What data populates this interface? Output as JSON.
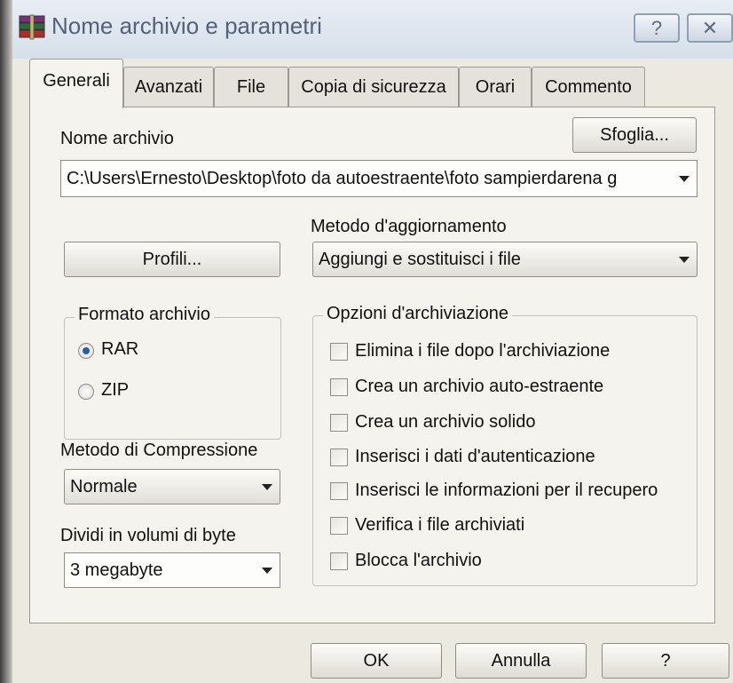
{
  "window": {
    "title": "Nome archivio e parametri",
    "help_label": "?",
    "close_label": "✕"
  },
  "tabs": [
    {
      "label": "Generali",
      "active": true
    },
    {
      "label": "Avanzati",
      "active": false
    },
    {
      "label": "File",
      "active": false
    },
    {
      "label": "Copia di sicurezza",
      "active": false
    },
    {
      "label": "Orari",
      "active": false
    },
    {
      "label": "Commento",
      "active": false
    }
  ],
  "general": {
    "archive_name_label": "Nome archivio",
    "browse_label": "Sfoglia...",
    "archive_path": "C:\\Users\\Ernesto\\Desktop\\foto da autoestraente\\foto sampierdarena g",
    "profiles_label": "Profili...",
    "update_method_label": "Metodo d'aggiornamento",
    "update_method_value": "Aggiungi e sostituisci i file",
    "format_group_label": "Formato archivio",
    "format_rar": "RAR",
    "format_zip": "ZIP",
    "format_selected": "RAR",
    "compression_label": "Metodo di Compressione",
    "compression_value": "Normale",
    "split_label": "Dividi in volumi di byte",
    "split_value": "3 megabyte",
    "options_group_label": "Opzioni d'archiviazione",
    "options": [
      {
        "label": "Elimina i file dopo l'archiviazione",
        "checked": false
      },
      {
        "label": "Crea un archivio auto-estraente",
        "checked": false
      },
      {
        "label": "Crea un archivio solido",
        "checked": false
      },
      {
        "label": "Inserisci i dati d'autenticazione",
        "checked": false
      },
      {
        "label": "Inserisci le informazioni per il recupero",
        "checked": false
      },
      {
        "label": "Verifica i file archiviati",
        "checked": false
      },
      {
        "label": "Blocca l'archivio",
        "checked": false
      }
    ]
  },
  "footer": {
    "ok_label": "OK",
    "cancel_label": "Annulla",
    "help_label": "?"
  },
  "colors": {
    "dialog_bg": "#ece9e0",
    "panel_bg": "#f4f3ee",
    "title_text": "#52627a",
    "radio_dot": "#2a5fae"
  }
}
